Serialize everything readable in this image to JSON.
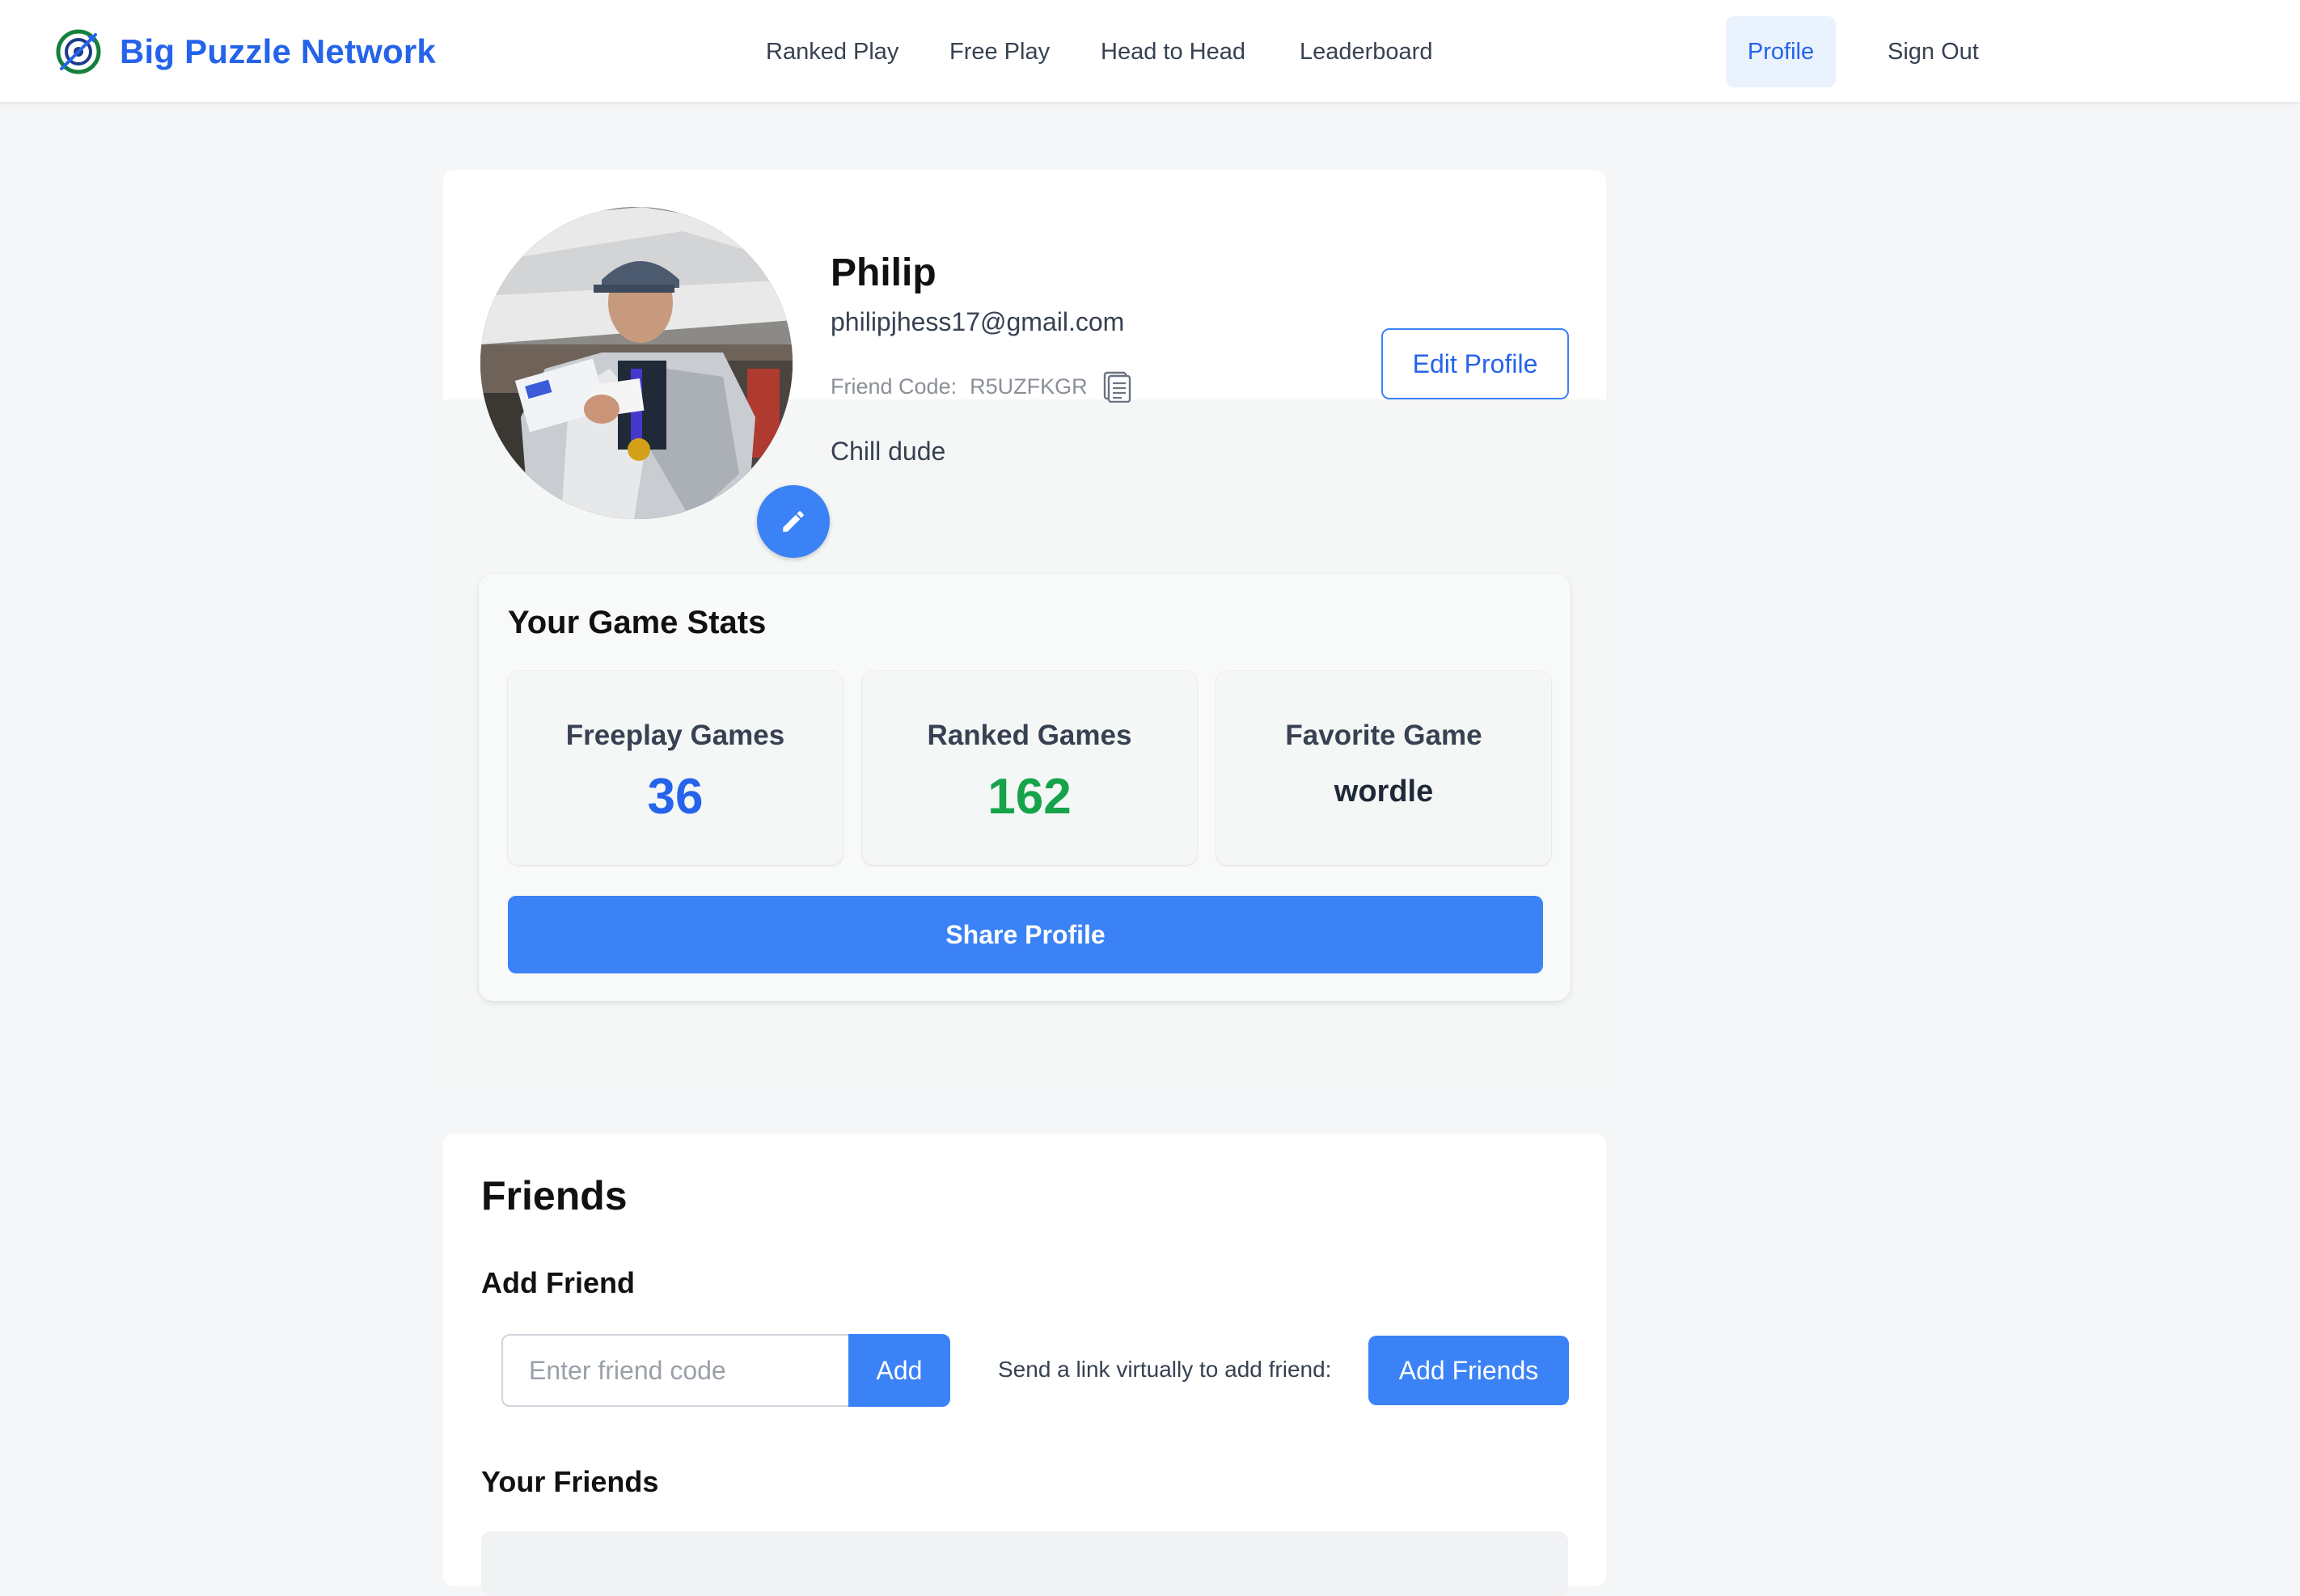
{
  "nav": {
    "brand": "Big Puzzle Network",
    "links": [
      "Ranked Play",
      "Free Play",
      "Head to Head",
      "Leaderboard"
    ],
    "profile": "Profile",
    "sign_out": "Sign Out"
  },
  "profile": {
    "name": "Philip",
    "email": "philipjhess17@gmail.com",
    "friend_code_label": "Friend Code:",
    "friend_code": "R5UZFKGR",
    "bio": "Chill dude",
    "edit_button": "Edit Profile"
  },
  "stats": {
    "title": "Your Game Stats",
    "freeplay_label": "Freeplay Games",
    "freeplay_value": "36",
    "ranked_label": "Ranked Games",
    "ranked_value": "162",
    "favorite_label": "Favorite Game",
    "favorite_value": "wordle",
    "share_button": "Share Profile"
  },
  "friends": {
    "title": "Friends",
    "add_title": "Add Friend",
    "input_placeholder": "Enter friend code",
    "add_button": "Add",
    "send_link_text": "Send a link virtually to add friend:",
    "add_friends_button": "Add Friends",
    "your_friends_title": "Your Friends"
  },
  "colors": {
    "brand": "#2563eb",
    "primary": "#3b82f6",
    "ranked_value": "#16a34a",
    "background": "#f5f6f7"
  },
  "icons": {
    "brand": "puzzle-logo-icon",
    "avatar_edit": "pencil-icon",
    "copy": "copy-icon"
  }
}
